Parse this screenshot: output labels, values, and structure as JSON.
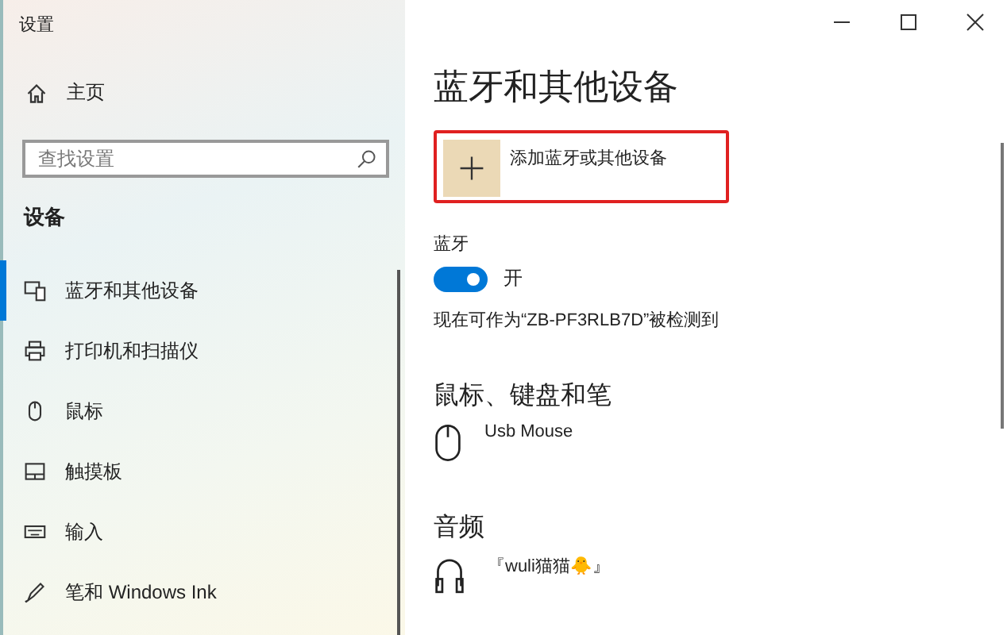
{
  "window": {
    "title": "设置"
  },
  "sidebar": {
    "home": "主页",
    "search": {
      "placeholder": "查找设置"
    },
    "section": "设备",
    "items": [
      {
        "label": "蓝牙和其他设备",
        "kind": "devices",
        "selected": true
      },
      {
        "label": "打印机和扫描仪",
        "kind": "printer",
        "selected": false
      },
      {
        "label": "鼠标",
        "kind": "mouse",
        "selected": false
      },
      {
        "label": "触摸板",
        "kind": "touchpad",
        "selected": false
      },
      {
        "label": "输入",
        "kind": "keyboard",
        "selected": false
      },
      {
        "label": "笔和 Windows Ink",
        "kind": "pen",
        "selected": false
      }
    ]
  },
  "main": {
    "title": "蓝牙和其他设备",
    "add_button": "添加蓝牙或其他设备",
    "bluetooth": {
      "label": "蓝牙",
      "on": true,
      "state_text": "开",
      "discoverable": "现在可作为“ZB-PF3RLB7D”被检测到"
    },
    "sections": [
      {
        "heading": "鼠标、键盘和笔",
        "devices": [
          {
            "name": "Usb Mouse",
            "kind": "mouse"
          }
        ]
      },
      {
        "heading": "音频",
        "devices": [
          {
            "name": "『wuli猫猫🐥』",
            "kind": "headphones"
          }
        ]
      }
    ]
  }
}
